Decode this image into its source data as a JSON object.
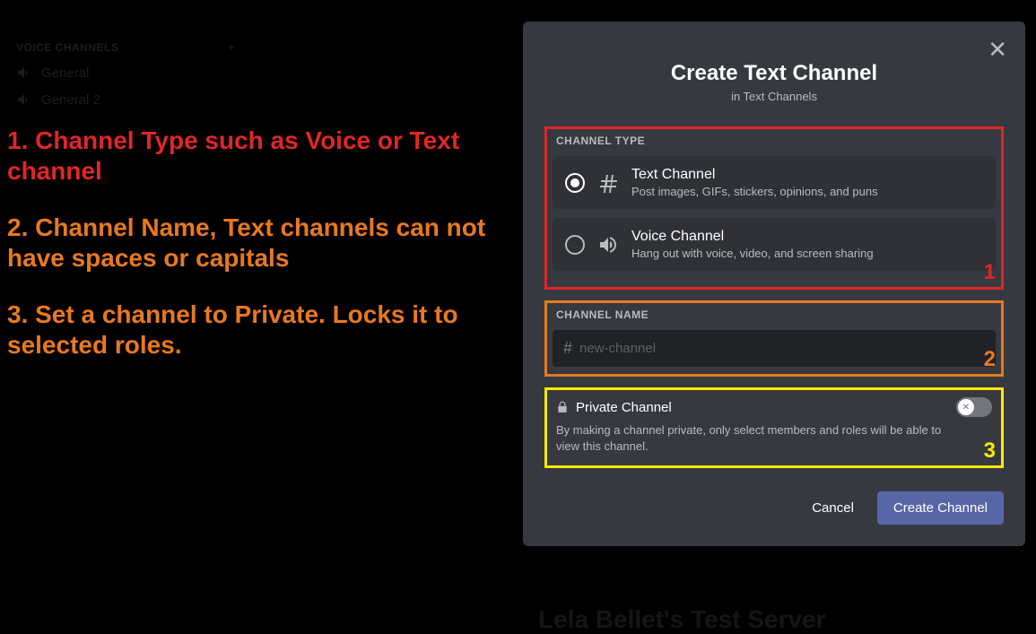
{
  "sidebar": {
    "header": "VOICE CHANNELS",
    "items": [
      {
        "label": "General"
      },
      {
        "label": "General 2"
      }
    ]
  },
  "annotations": {
    "a1": "1. Channel Type such as Voice or Text channel",
    "a2": "2. Channel Name, Text channels can not have spaces or capitals",
    "a3": "3. Set a channel to Private. Locks it to selected roles."
  },
  "modal": {
    "title": "Create Text Channel",
    "subtitle": "in Text Channels",
    "channel_type_label": "CHANNEL TYPE",
    "types": {
      "text": {
        "title": "Text Channel",
        "desc": "Post images, GIFs, stickers, opinions, and puns"
      },
      "voice": {
        "title": "Voice Channel",
        "desc": "Hang out with voice, video, and screen sharing"
      }
    },
    "channel_name_label": "CHANNEL NAME",
    "channel_name_placeholder": "new-channel",
    "private": {
      "title": "Private Channel",
      "desc": "By making a channel private, only select members and roles will be able to view this channel."
    },
    "buttons": {
      "cancel": "Cancel",
      "create": "Create Channel"
    }
  },
  "box_numbers": {
    "n1": "1",
    "n2": "2",
    "n3": "3"
  },
  "footer": "Lela Bellet's Test Server"
}
